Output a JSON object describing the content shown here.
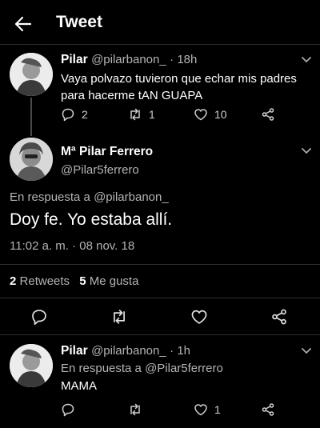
{
  "header": {
    "title": "Tweet"
  },
  "tweet1": {
    "name": "Pilar",
    "handle": "@pilarbanon_",
    "time": "· 18h",
    "text_line1": "Vaya polvazo tuvieron que echar mis padres",
    "text_line2": "para hacerme tAN GUAPA",
    "replies": "2",
    "retweets": "1",
    "likes": "10"
  },
  "main": {
    "name": "Mª Pilar Ferrero",
    "handle": "@Pilar5ferrero",
    "reply_to": "En respuesta a @pilarbanon_",
    "text": "Doy fe. Yo estaba allí.",
    "timestamp": "11:02 a. m. · 08 nov. 18",
    "retweets_count": "2",
    "retweets_label": "Retweets",
    "likes_count": "5",
    "likes_label": "Me gusta"
  },
  "tweet3": {
    "name": "Pilar",
    "handle": "@pilarbanon_",
    "time": "· 1h",
    "reply_to": "En respuesta a @Pilar5ferrero",
    "text": "MAMA",
    "likes": "1"
  },
  "icons": [
    "back-arrow-icon",
    "reply-icon",
    "retweet-icon",
    "like-icon",
    "share-icon",
    "chevron-down-icon"
  ]
}
